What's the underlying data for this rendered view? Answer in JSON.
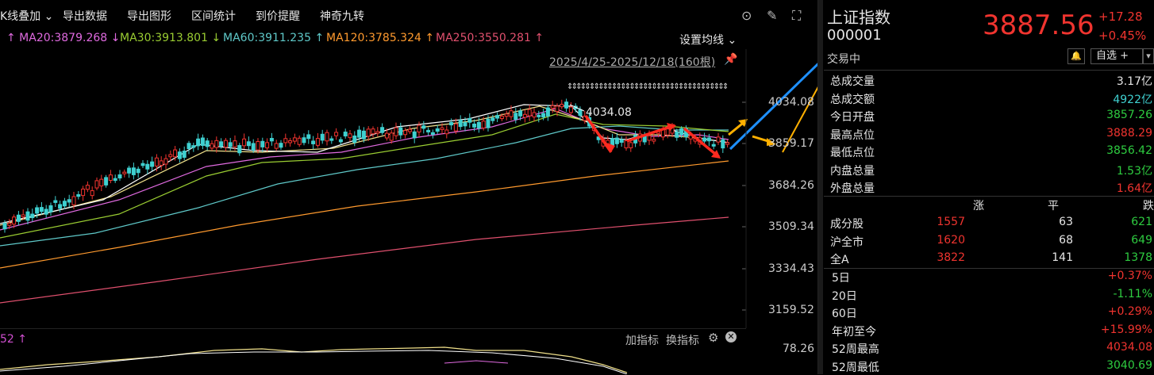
{
  "toolbar": {
    "items": [
      "K线叠加",
      "导出数据",
      "导出图形",
      "区间统计",
      "到价提醒",
      "神奇九转"
    ],
    "dropdown_icon": "chevron-down-icon"
  },
  "ma_line": {
    "items": [
      {
        "text": "↑ MA20:3879.268 ↓",
        "color": "#e06ae0"
      },
      {
        "text": "MA30:3913.801 ↓",
        "color": "#9acd32"
      },
      {
        "text": "MA60:3911.235 ↑",
        "color": "#5fc9c9"
      },
      {
        "text": "MA120:3785.324 ↑",
        "color": "#ff9a2e"
      },
      {
        "text": "MA250:3550.281 ↑",
        "color": "#e0506e"
      }
    ],
    "settings_label": "设置均线"
  },
  "range_label": "2025/4/25-2025/12/18(160根)",
  "high_marker": "4034.08",
  "price_ticks": [
    "4034.08",
    "3859.17",
    "3684.26",
    "3509.34",
    "3334.43",
    "3159.52"
  ],
  "sub_panel": {
    "left_value": "52 ↑",
    "add_indicator": "加指标",
    "switch_indicator": "换指标",
    "tick": "78.26"
  },
  "quote": {
    "name": "上证指数",
    "code": "000001",
    "price": "3887.56",
    "change": "+17.28",
    "change_pct": "+0.45%",
    "status": "交易中",
    "watch_label": "自选 +",
    "more_label": "▾"
  },
  "stats": [
    {
      "label": "总成交量",
      "value": "3.17亿",
      "color": "#e6e6e6"
    },
    {
      "label": "总成交额",
      "value": "4922亿",
      "color": "#3fd0d0"
    },
    {
      "label": "今日开盘",
      "value": "3857.26",
      "color": "#2ecc40"
    },
    {
      "label": "最高点位",
      "value": "3888.29",
      "color": "#f0342f"
    },
    {
      "label": "最低点位",
      "value": "3856.42",
      "color": "#2ecc40"
    },
    {
      "label": "内盘总量",
      "value": "1.53亿",
      "color": "#2ecc40"
    },
    {
      "label": "外盘总量",
      "value": "1.64亿",
      "color": "#f0342f"
    }
  ],
  "breadth": {
    "headers": [
      "涨",
      "平",
      "跌"
    ],
    "rows": [
      {
        "label": "成分股",
        "up": "1557",
        "flat": "63",
        "down": "621"
      },
      {
        "label": "沪全市",
        "up": "1620",
        "flat": "68",
        "down": "649"
      },
      {
        "label": "全A",
        "up": "3822",
        "flat": "141",
        "down": "1378"
      }
    ]
  },
  "periods": [
    {
      "label": "5日",
      "value": "+0.37%",
      "color": "#f0342f"
    },
    {
      "label": "20日",
      "value": "-1.11%",
      "color": "#2ecc40"
    },
    {
      "label": "60日",
      "value": "+0.29%",
      "color": "#f0342f"
    },
    {
      "label": "年初至今",
      "value": "+15.99%",
      "color": "#f0342f"
    },
    {
      "label": "52周最高",
      "value": "4034.08",
      "color": "#f0342f"
    },
    {
      "label": "52周最低",
      "value": "3040.69",
      "color": "#2ecc40"
    }
  ]
}
